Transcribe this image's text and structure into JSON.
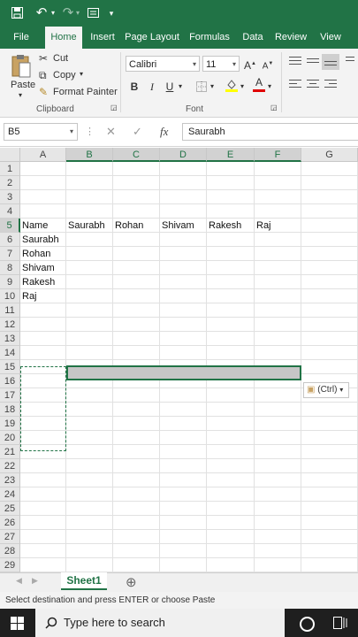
{
  "quick_access": {
    "icons": [
      "save-icon",
      "undo-icon",
      "redo-icon",
      "form-icon",
      "customize-arrow-icon"
    ]
  },
  "ribbon_tabs": [
    "File",
    "Home",
    "Insert",
    "Page Layout",
    "Formulas",
    "Data",
    "Review",
    "View"
  ],
  "active_tab": "Home",
  "clipboard": {
    "paste": "Paste",
    "cut": "Cut",
    "copy": "Copy",
    "format_painter": "Format Painter",
    "group_label": "Clipboard"
  },
  "font": {
    "name": "Calibri",
    "size": "11",
    "grow_label": "A",
    "shrink_label": "A",
    "bold": "B",
    "italic": "I",
    "underline": "U",
    "font_color_letter": "A",
    "group_label": "Font"
  },
  "formula_bar": {
    "name_box": "B5",
    "fx_label": "fx",
    "content": "Saurabh"
  },
  "columns": [
    "A",
    "B",
    "C",
    "D",
    "E",
    "F",
    "G"
  ],
  "selected_columns": [
    "B",
    "C",
    "D",
    "E",
    "F"
  ],
  "rows": [
    "1",
    "2",
    "3",
    "4",
    "5",
    "6",
    "7",
    "8",
    "9",
    "10",
    "11",
    "12",
    "13",
    "14",
    "15",
    "16",
    "17",
    "18",
    "19",
    "20",
    "21",
    "22",
    "23",
    "24",
    "25",
    "26",
    "27",
    "28",
    "29"
  ],
  "selected_row": "5",
  "cells": {
    "A5": "Name",
    "A6": "Saurabh",
    "A7": "Rohan",
    "A8": "Shivam",
    "A9": "Rakesh",
    "A10": "Raj",
    "B5": "Saurabh",
    "C5": "Rohan",
    "D5": "Shivam",
    "E5": "Rakesh",
    "F5": "Raj"
  },
  "paste_options": "(Ctrl)",
  "sheets": [
    "Sheet1"
  ],
  "active_sheet": "Sheet1",
  "status_text": "Select destination and press ENTER or choose Paste",
  "taskbar": {
    "search_placeholder": "Type here to search"
  },
  "colors": {
    "excel_green": "#217346",
    "taskbar": "#1f1f1f",
    "selection_fill": "#c6c6c6"
  }
}
